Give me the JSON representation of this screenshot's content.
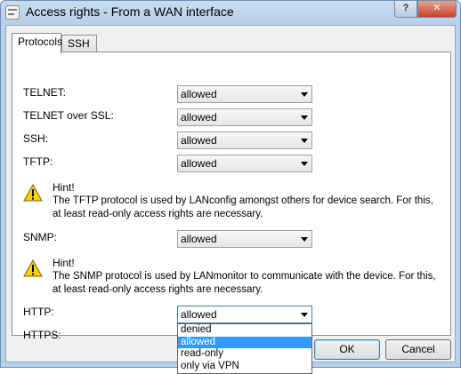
{
  "window": {
    "title": "Access rights - From a WAN interface",
    "help_label": "?",
    "close_label": "✕"
  },
  "tabs": [
    {
      "label": "Protocols",
      "active": true
    },
    {
      "label": "SSH",
      "active": false
    }
  ],
  "rows": {
    "telnet": {
      "label": "TELNET:",
      "value": "allowed"
    },
    "telnet_ssl": {
      "label": "TELNET over SSL:",
      "value": "allowed"
    },
    "ssh": {
      "label": "SSH:",
      "value": "allowed"
    },
    "tftp": {
      "label": "TFTP:",
      "value": "allowed"
    },
    "snmp": {
      "label": "SNMP:",
      "value": "allowed"
    },
    "http": {
      "label": "HTTP:",
      "value": "allowed"
    },
    "https": {
      "label": "HTTPS:"
    }
  },
  "hints": {
    "tftp": {
      "title": "Hint!",
      "text": "The TFTP protocol is used by LANconfig amongst others for device search. For this, at least read-only access rights are necessary."
    },
    "snmp": {
      "title": "Hint!",
      "text": "The SNMP protocol is used by LANmonitor to communicate with the device. For this, at least read-only access rights are necessary."
    }
  },
  "dropdown": {
    "options": [
      "denied",
      "allowed",
      "read-only",
      "only via VPN"
    ],
    "selected_index": 1
  },
  "buttons": {
    "ok": "OK",
    "cancel": "Cancel"
  },
  "colors": {
    "selection": "#3399ff",
    "title_bar": "#b9d1ea",
    "close_button": "#c7432a"
  }
}
